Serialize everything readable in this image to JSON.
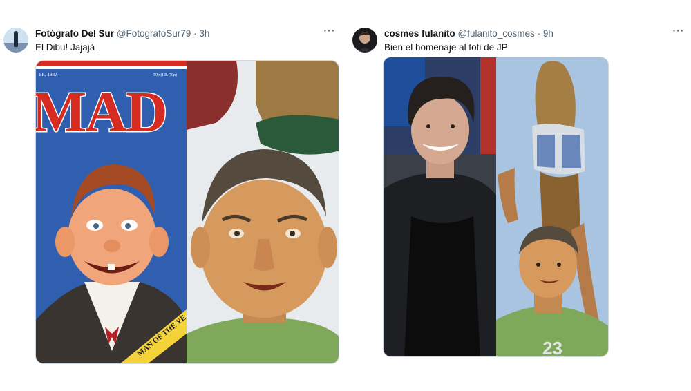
{
  "tweets": [
    {
      "author_name": "Fotógrafo Del Sur",
      "handle": "@FotografoSur79",
      "separator": "·",
      "time": "3h",
      "text": "El Dibu!  Jajajá",
      "media": {
        "magazine_title": "MAD",
        "magazine_date": "ER, 1982",
        "magazine_price": "50p (I.R. 70p)",
        "banner_text": "MAN OF THE YE"
      }
    },
    {
      "author_name": "cosmes fulanito",
      "handle": "@fulanito_cosmes",
      "separator": "·",
      "time": "9h",
      "text": "Bien el homenaje al toti de JP"
    }
  ],
  "icons": {
    "more": "more-horizontal-icon"
  },
  "colors": {
    "text_primary": "#0f1419",
    "text_secondary": "#536471",
    "border": "#cfd9de",
    "mad_blue": "#2f5fae",
    "mad_red": "#d62b20"
  }
}
